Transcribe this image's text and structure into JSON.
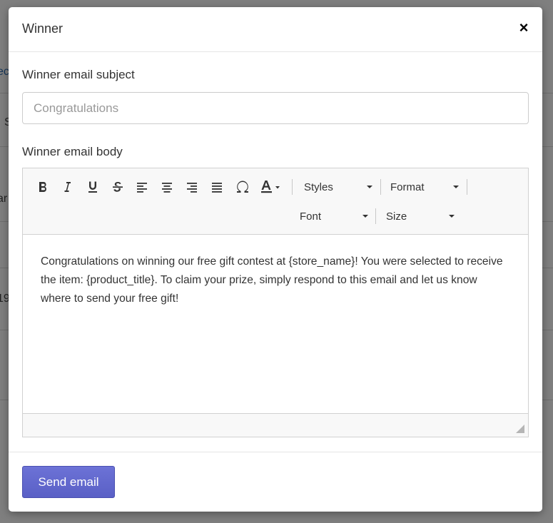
{
  "background": {
    "fragments": [
      "ec",
      "S",
      "ar",
      "19"
    ]
  },
  "modal": {
    "title": "Winner",
    "close_label": "×"
  },
  "subject": {
    "label": "Winner email subject",
    "placeholder": "Congratulations",
    "value": ""
  },
  "body": {
    "label": "Winner email body",
    "content": "Congratulations on winning our free gift contest at {store_name}! You were selected to receive the item: {product_title}. To claim your prize, simply respond to this email and let us know where to send your free gift!"
  },
  "toolbar": {
    "buttons": [
      "bold-icon",
      "italic-icon",
      "underline-icon",
      "strikethrough-icon",
      "align-left-icon",
      "align-center-icon",
      "align-right-icon",
      "align-justify-icon",
      "special-character-icon",
      "text-color-icon"
    ],
    "styles_label": "Styles",
    "format_label": "Format",
    "font_label": "Font",
    "size_label": "Size"
  },
  "footer": {
    "send_label": "Send email"
  },
  "colors": {
    "primary_button": "#5c63c8"
  }
}
